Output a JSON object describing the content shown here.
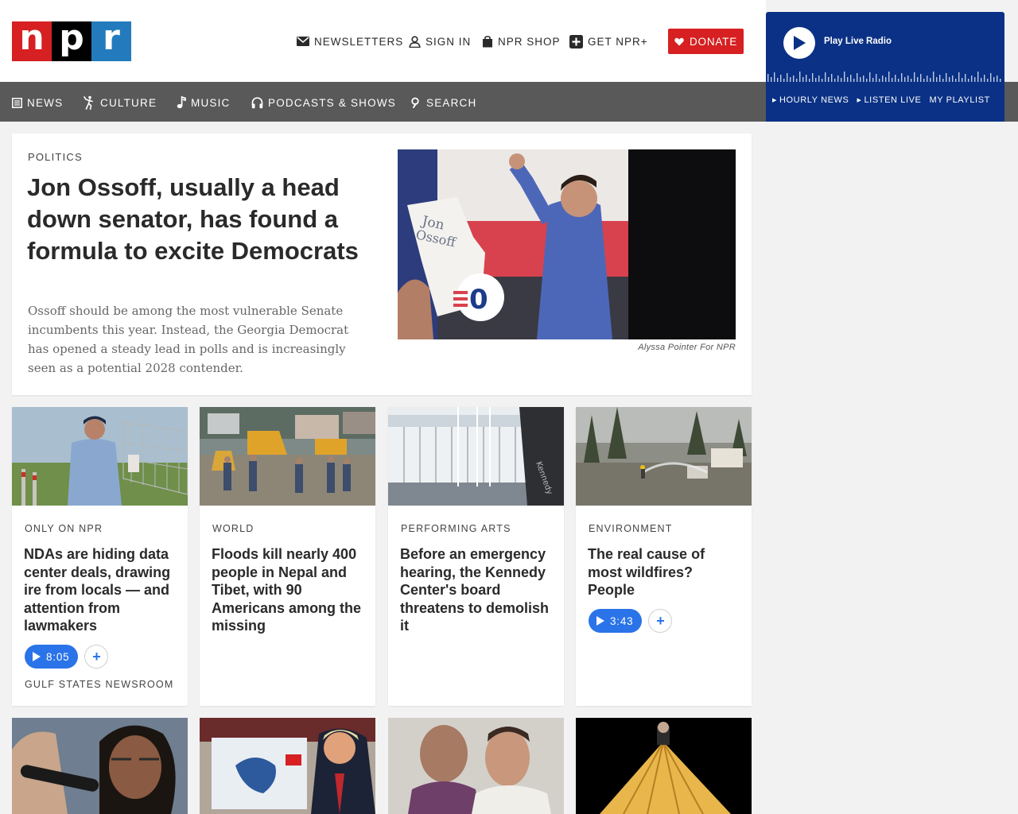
{
  "logo": {
    "letters": [
      "n",
      "p",
      "r"
    ]
  },
  "header": {
    "links": [
      {
        "label": "NEWSLETTERS",
        "icon": "envelope-icon"
      },
      {
        "label": "SIGN IN",
        "icon": "user-icon"
      },
      {
        "label": "NPR SHOP",
        "icon": "shopping-bag-icon"
      },
      {
        "label": "GET NPR+",
        "icon": "plus-square-icon"
      }
    ],
    "donate": "DONATE"
  },
  "nav": {
    "items": [
      {
        "label": "NEWS",
        "icon": "newspaper-icon"
      },
      {
        "label": "CULTURE",
        "icon": "culture-icon"
      },
      {
        "label": "MUSIC",
        "icon": "music-note-icon"
      },
      {
        "label": "PODCASTS & SHOWS",
        "icon": "headphones-icon"
      },
      {
        "label": "SEARCH",
        "icon": "search-icon"
      }
    ]
  },
  "live_radio": {
    "label": "Play Live Radio",
    "links": [
      "HOURLY NEWS",
      "LISTEN LIVE",
      "MY PLAYLIST"
    ]
  },
  "hero": {
    "slug": "POLITICS",
    "title": "Jon Ossoff, usually a head down senator, has found a formula to excite Democrats",
    "teaser": "Ossoff should be among the most vulnerable Senate incumbents this year. Instead, the Georgia Democrat has opened a steady lead in polls and is increasingly seen as a potential 2028 contender.",
    "credit": "Alyssa Pointer For NPR"
  },
  "cards": [
    {
      "slug": "ONLY ON NPR",
      "title": "NDAs are hiding data center deals, drawing ire from locals — and attention from lawmakers",
      "duration": "8:05",
      "source": "GULF STATES NEWSROOM"
    },
    {
      "slug": "WORLD",
      "title": "Floods kill nearly 400 people in Nepal and Tibet, with 90 Americans among the missing"
    },
    {
      "slug": "PERFORMING ARTS",
      "title": "Before an emergency hearing, the Kennedy Center's board threatens to demolish it"
    },
    {
      "slug": "ENVIRONMENT",
      "title": "The real cause of most wildfires? People",
      "duration": "3:43"
    }
  ],
  "colors": {
    "npr_red": "#d62021",
    "npr_black": "#000000",
    "npr_blue": "#237bbd",
    "nav_gray": "#595959",
    "radio_blue": "#0a3185",
    "audio_blue": "#2a73e8"
  }
}
